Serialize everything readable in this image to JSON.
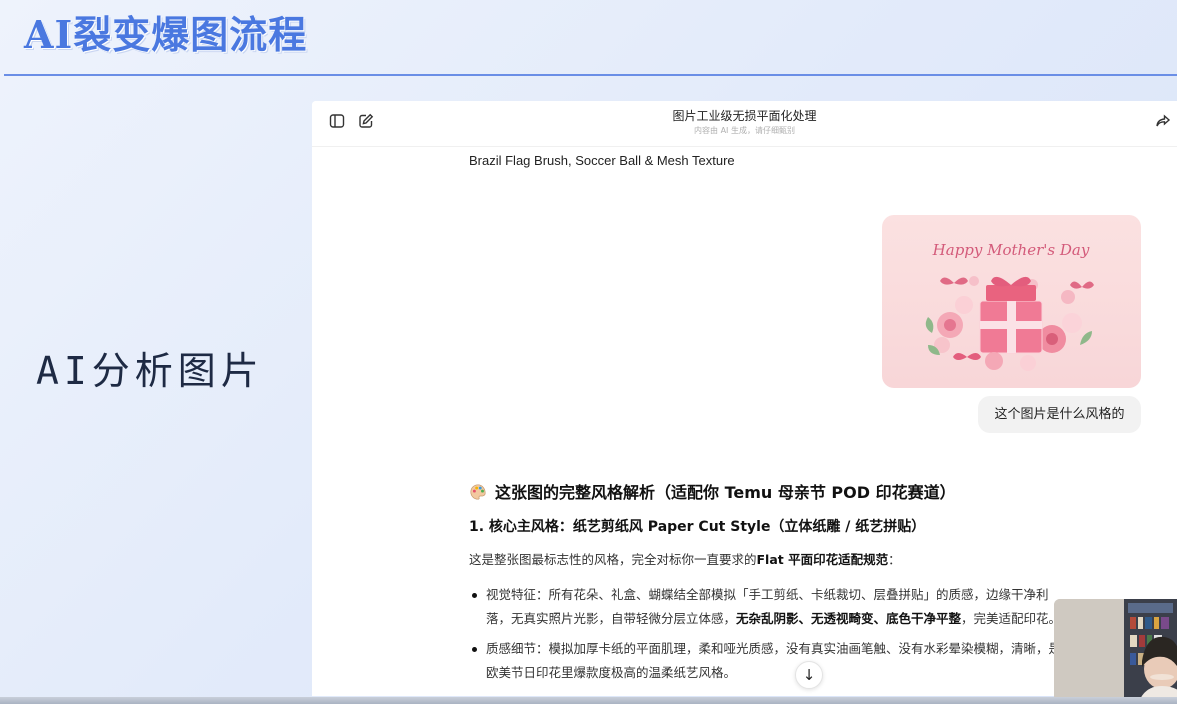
{
  "slide": {
    "title": "AI裂变爆图流程",
    "side_label": "AI分析图片"
  },
  "chat": {
    "title": "图片工业级无损平面化处理",
    "subtitle": "内容由 AI 生成，请仔细甄别",
    "previous_text": "Brazil Flag Brush, Soccer Ball & Mesh Texture",
    "user_image": {
      "caption_text": "Happy Mother's Day",
      "colors": {
        "background": "#f8d6d8",
        "accent": "#e06a85",
        "gift": "#f07a95"
      }
    },
    "user_message": "这个图片是什么风格的",
    "answer": {
      "heading": "这张图的完整风格解析（适配你 Temu 母亲节 POD 印花赛道）",
      "heading_icon": "palette-icon",
      "subheading": "1. 核心主风格：纸艺剪纸风 Paper Cut Style（立体纸雕 / 纸艺拼贴）",
      "intro_prefix": "这是整张图最标志性的风格，完全对标你一直要求的",
      "intro_bold": "Flat 平面印花适配规范",
      "intro_suffix": "：",
      "bullet1": {
        "text_a": "视觉特征：所有花朵、礼盒、蝴蝶结全部模拟「手工剪纸、卡纸裁切、层叠拼贴」的质感，边缘干净利落，无真实照片光影，自带轻微分层立体感，",
        "bold": "无杂乱阴影、无透视畸变、底色干净平整",
        "text_b": "，完美适配印花。"
      },
      "bullet2": {
        "text": "质感细节：模拟加厚卡纸的平面肌理，柔和哑光质感，没有真实油画笔触、没有水彩晕染模糊，清晰，是欧美节日印花里爆款度极高的温柔纸艺风格。"
      }
    }
  },
  "icons": {
    "sidebar_toggle": "sidebar-toggle-icon",
    "new_chat": "edit-icon",
    "share": "share-icon",
    "scroll_down": "arrow-down-icon"
  },
  "colors": {
    "title_blue": "#4a78e0",
    "rule_blue": "#6a8ee6"
  }
}
